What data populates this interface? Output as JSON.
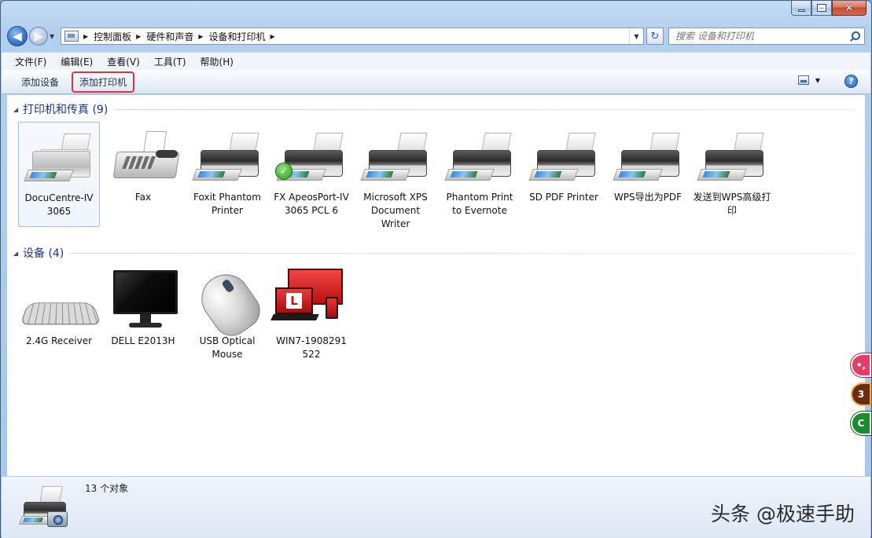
{
  "window": {
    "caption_buttons": [
      "minimize",
      "maximize",
      "close"
    ]
  },
  "nav": {
    "breadcrumbs": [
      "控制面板",
      "硬件和声音",
      "设备和打印机"
    ],
    "search_placeholder": "搜索 设备和打印机"
  },
  "menubar": {
    "items": [
      "文件(F)",
      "编辑(E)",
      "查看(V)",
      "工具(T)",
      "帮助(H)"
    ]
  },
  "commandbar": {
    "add_device": "添加设备",
    "add_printer": "添加打印机",
    "highlight_color": "#e1323b"
  },
  "groups": {
    "printers": {
      "title": "打印机和传真 (9)",
      "items": [
        {
          "label": "DocuCentre-IV 3065",
          "icon": "printer-icon",
          "selected": true
        },
        {
          "label": "Fax",
          "icon": "fax-icon"
        },
        {
          "label": "Foxit Phantom Printer",
          "icon": "printer-icon"
        },
        {
          "label": "FX ApeosPort-IV 3065 PCL 6",
          "icon": "printer-icon",
          "default": true
        },
        {
          "label": "Microsoft XPS Document Writer",
          "icon": "printer-icon"
        },
        {
          "label": "Phantom Print to Evernote",
          "icon": "printer-icon"
        },
        {
          "label": "SD PDF Printer",
          "icon": "printer-icon"
        },
        {
          "label": "WPS导出为PDF",
          "icon": "printer-icon"
        },
        {
          "label": "发送到WPS高级打印",
          "icon": "printer-icon"
        }
      ]
    },
    "devices": {
      "title": "设备 (4)",
      "items": [
        {
          "label": "2.4G Receiver",
          "icon": "keyboard-icon"
        },
        {
          "label": "DELL E2013H",
          "icon": "monitor-icon"
        },
        {
          "label": "USB Optical Mouse",
          "icon": "mouse-icon"
        },
        {
          "label": "WIN7-1908291 522",
          "icon": "computer-icon"
        }
      ]
    }
  },
  "statusbar": {
    "count_text": "13 个对象"
  },
  "watermark": {
    "text": "头条 @极速手助"
  },
  "floating_badges": [
    "•,",
    "3",
    "C"
  ]
}
